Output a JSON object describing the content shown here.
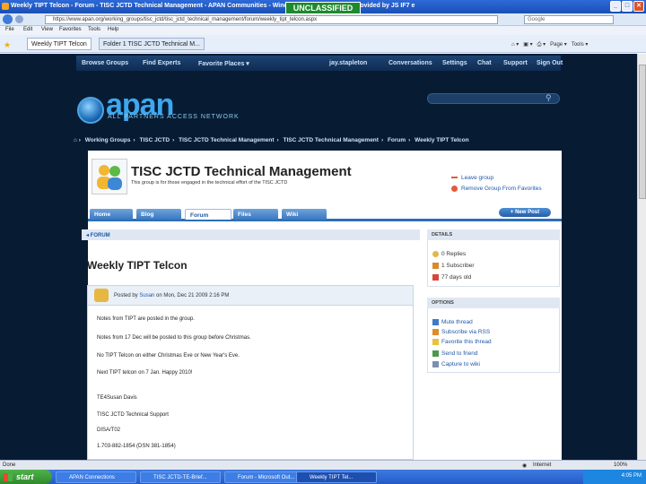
{
  "browser": {
    "window_title": "Weekly TIPT Telcon - Forum - TISC JCTD Technical Management - APAN Communities - Windows Internet Explorer provided by JS IF7 e",
    "classification": "UNCLASSIFIED",
    "address": "https://www.apan.org/working_groups/tisc_jctd/tisc_jctd_technical_management/forum/weekly_tipt_telcon.aspx",
    "search_placeholder": "Google",
    "menu": [
      "File",
      "Edit",
      "View",
      "Favorites",
      "Tools",
      "Help"
    ],
    "tabs": [
      "Weekly TIPT Telcon",
      "Folder 1 TISC JCTD Technical M..."
    ]
  },
  "site": {
    "topnav": [
      "Browse Groups",
      "Find Experts",
      "Favorite Places ▾",
      "jay.stapleton",
      "Conversations",
      "Settings",
      "Chat",
      "Support",
      "Sign Out"
    ],
    "logo_text": "apan",
    "logo_sub": "ALL PARTNERS ACCESS NETWORK",
    "breadcrumbs": [
      "Working Groups",
      "TISC JCTD",
      "TISC JCTD Technical Management",
      "TISC JCTD Technical Management",
      "Forum",
      "Weekly TIPT Telcon"
    ]
  },
  "group": {
    "title": "TISC JCTD Technical Management",
    "description": "This group is for those engaged in the technical effort of the TISC JCTD",
    "leave": "Leave group",
    "remove_fav": "Remove Group From Favorites",
    "tabs": [
      "Home",
      "Blog",
      "Forum",
      "Files",
      "Wiki"
    ],
    "new_post": "+ New Post"
  },
  "forum": {
    "back": "◂ FORUM",
    "post_title": "Weekly TIPT Telcon",
    "posted_prefix": "Posted by",
    "author": "Susan",
    "posted_date": "on Mon, Dec 21 2009 2:16 PM",
    "body": [
      "Notes from TIPT are posted in the group.",
      "Notes from 17 Dec will be posted to this group before Christmas.",
      "No TIPT Telcon on either Christmas Eve or New Year's Eve.",
      "Next TIPT telcon on 7 Jan. Happy 2010!",
      "TE4Susan Davis",
      "TISC JCTD Technical Support",
      "DISA/T02",
      "1.703-882-1854 (DSN 381-1854)"
    ]
  },
  "sidebar": {
    "details_title": "DETAILS",
    "replies": "0 Replies",
    "subscriber": "1 Subscriber",
    "age": "77 days old",
    "options_title": "OPTIONS",
    "options": [
      "Mute thread",
      "Subscribe via RSS",
      "Favorite this thread",
      "Send to friend",
      "Capture to wiki"
    ]
  },
  "statusbar": {
    "left": "Done",
    "right": "Internet",
    "zoom": "100%"
  },
  "taskbar": {
    "start": "start",
    "items": [
      "APAN Connections",
      "TISC JCTD-TE-Brief...",
      "Forum - Microsoft Out...",
      "Weekly TIPT Tel..."
    ],
    "clock": "4:05 PM"
  }
}
